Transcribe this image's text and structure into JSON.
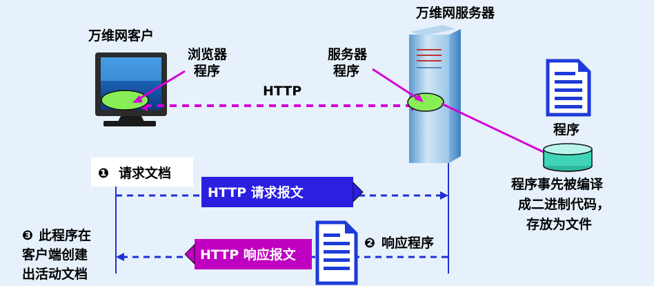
{
  "labels": {
    "client_title": "万维网客户",
    "server_title": "万维网服务器",
    "browser_line1": "浏览器",
    "browser_line2": "程序",
    "server_prog_line1": "服务器",
    "server_prog_line2": "程序",
    "http": "HTTP",
    "doc_program": "程序",
    "compiled_line1": "程序事先被编译",
    "compiled_line2": "成二进制代码，",
    "compiled_line3": "存放为文件",
    "step1": "请求文档",
    "step1_marker": "❶",
    "request_msg": "HTTP 请求报文",
    "step2": "响应程序",
    "step2_marker": "❷",
    "response_msg": "HTTP 响应报文",
    "step3_marker": "❸",
    "step3_line1": "此程序在",
    "step3_line2": "客户端创建",
    "step3_line3": "出活动文档"
  },
  "colors": {
    "background": "#e6f1fb",
    "magenta": "#d400d4",
    "request_arrow": "#2b20e0",
    "response_arrow": "#c000c0",
    "dashed_line": "#1e2fd6",
    "ellipse_fill": "#88ee55",
    "document_blue": "#1e3ad8",
    "cylinder_fill": "#3fd4b8"
  }
}
